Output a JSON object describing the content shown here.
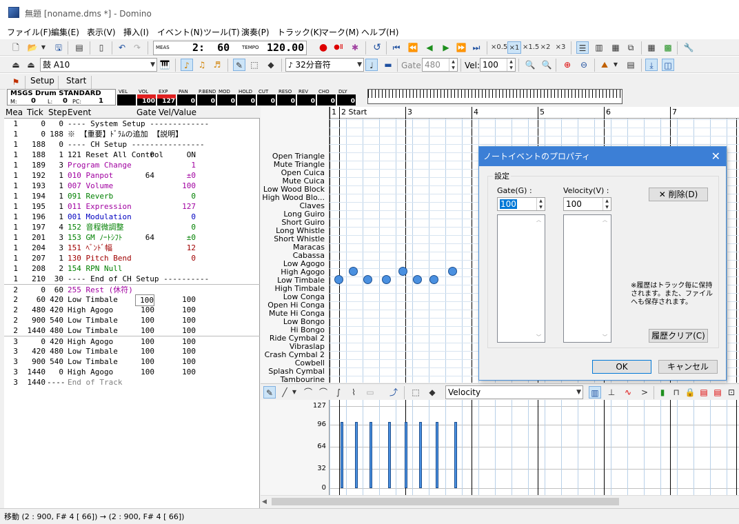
{
  "window": {
    "title": "無題 [noname.dms *] - Domino"
  },
  "menu": [
    "ファイル(F)",
    "編集(E)",
    "表示(V)",
    "挿入(I)",
    "イベント(N)",
    "ツール(T)",
    "演奏(P)",
    "トラック(K)",
    "マーク(M)",
    "ヘルプ(H)"
  ],
  "toolbar1": {
    "meas_label": "MEAS",
    "position": "2:  60",
    "tempo_label": "TEMPO",
    "tempo": "120.00",
    "speeds": [
      "×0.5",
      "×1",
      "×1.5",
      "×2",
      "×3"
    ]
  },
  "toolbar2": {
    "instrument": "鼓 A10",
    "note_length": "32分音符",
    "gate_label": "Gate:",
    "gate_value": "480",
    "vel_label": "Vel:",
    "vel_value": "100"
  },
  "toolbar3": {
    "setup": "Setup",
    "start": "Start"
  },
  "channel_info": {
    "device": "MSGS Drum STANDARD",
    "m_label": "M:",
    "m_value": "0",
    "l_label": "L:",
    "l_value": "0",
    "pc_label": "PC:",
    "pc_value": "1",
    "meters": [
      {
        "label": "VEL",
        "value": ""
      },
      {
        "label": "VOL",
        "value": "100"
      },
      {
        "label": "EXP",
        "value": "127"
      },
      {
        "label": "PAN",
        "value": "0"
      },
      {
        "label": "P.BEND",
        "value": "0"
      },
      {
        "label": "MOD",
        "value": "0"
      },
      {
        "label": "HOLD",
        "value": "0"
      },
      {
        "label": "CUT",
        "value": "0"
      },
      {
        "label": "RESO",
        "value": "0"
      },
      {
        "label": "REV",
        "value": "0"
      },
      {
        "label": "CHO",
        "value": "0"
      },
      {
        "label": "DLY",
        "value": "0"
      }
    ]
  },
  "event_list": {
    "headers": [
      "Mea",
      "Tick",
      "Step",
      "Event",
      "Gate",
      "Vel/Value"
    ],
    "rows": [
      [
        "1",
        "0",
        "0",
        "---- System Setup -------------",
        "",
        "",
        "#000"
      ],
      [
        "1",
        "0",
        "188",
        "※ 【重要】ﾄﾞﾗﾑの追加 【説明】",
        "",
        "",
        "#000"
      ],
      [
        "1",
        "188",
        "0",
        "---- CH Setup ----------------",
        "",
        "",
        "#000"
      ],
      [
        "1",
        "188",
        "1",
        "121 Reset All Control",
        "0",
        "ON",
        "#000"
      ],
      [
        "1",
        "189",
        "3",
        "Program Change",
        "",
        "1",
        "#a000a0"
      ],
      [
        "1",
        "192",
        "1",
        "010 Panpot",
        "64",
        "±0",
        "#a000a0"
      ],
      [
        "1",
        "193",
        "1",
        "007 Volume",
        "",
        "100",
        "#a000a0"
      ],
      [
        "1",
        "194",
        "1",
        "091 Reverb",
        "",
        "0",
        "#008000"
      ],
      [
        "1",
        "195",
        "1",
        "011 Expression",
        "",
        "127",
        "#a000a0"
      ],
      [
        "1",
        "196",
        "1",
        "001 Modulation",
        "",
        "0",
        "#0000c0"
      ],
      [
        "1",
        "197",
        "4",
        "152 音程微調整",
        "",
        "0",
        "#008000"
      ],
      [
        "1",
        "201",
        "3",
        "153 GM ﾉｰﾄｼﾌﾄ",
        "64",
        "±0",
        "#008000"
      ],
      [
        "1",
        "204",
        "3",
        "151 ﾍﾞﾝﾄﾞ幅",
        "",
        "12",
        "#a00000"
      ],
      [
        "1",
        "207",
        "1",
        "130 Pitch Bend",
        "",
        "0",
        "#a00000"
      ],
      [
        "1",
        "208",
        "2",
        "154 RPN Null",
        "",
        "",
        "#008000"
      ],
      [
        "1",
        "210",
        "30",
        "---- End of CH Setup ----------",
        "",
        "",
        "#000"
      ],
      [
        "2",
        "0",
        "60",
        "255 Rest (休符)",
        "",
        "",
        "#a000a0"
      ],
      [
        "2",
        "60",
        "420",
        "Low Timbale",
        "100",
        "100",
        "#000"
      ],
      [
        "2",
        "480",
        "420",
        "High Agogo",
        "100",
        "100",
        "#000"
      ],
      [
        "2",
        "900",
        "540",
        "Low Timbale",
        "100",
        "100",
        "#000"
      ],
      [
        "2",
        "1440",
        "480",
        "Low Timbale",
        "100",
        "100",
        "#000"
      ],
      [
        "3",
        "0",
        "420",
        "High Agogo",
        "100",
        "100",
        "#000"
      ],
      [
        "3",
        "420",
        "480",
        "Low Timbale",
        "100",
        "100",
        "#000"
      ],
      [
        "3",
        "900",
        "540",
        "Low Timbale",
        "100",
        "100",
        "#000"
      ],
      [
        "3",
        "1440",
        "0",
        "High Agogo",
        "100",
        "100",
        "#000"
      ],
      [
        "3",
        "1440",
        "----",
        "End of Track",
        "",
        "",
        "#808080"
      ]
    ]
  },
  "piano_roll": {
    "measures": [
      "1",
      "2 Start",
      "3",
      "4",
      "5",
      "6",
      "7"
    ],
    "note_names": [
      "Open Triangle",
      "Mute Triangle",
      "Open Cuica",
      "Mute Cuica",
      "Low Wood Block",
      "High Wood Blo...",
      "Claves",
      "Long Guiro",
      "Short Guiro",
      "Long Whistle",
      "Short Whistle",
      "Maracas",
      "Cabassa",
      "Low Agogo",
      "High Agogo",
      "Low Timbale",
      "High Timbale",
      "Low Conga",
      "Open Hi Conga",
      "Mute Hi Conga",
      "Low Bongo",
      "Hi Bongo",
      "Ride Cymbal 2",
      "Vibraslap",
      "Crash Cymbal 2",
      "Cowbell",
      "Splash Cymbal",
      "Tambourine"
    ]
  },
  "controller": {
    "type": "Velocity",
    "scale": [
      "127",
      "96",
      "64",
      "32",
      "0"
    ]
  },
  "dialog": {
    "title": "ノートイベントのプロパティ",
    "group_label": "設定",
    "gate_label": "Gate(G) :",
    "gate_value": "100",
    "velocity_label": "Velocity(V) :",
    "velocity_value": "100",
    "delete_button": "削除(D)",
    "note": "※履歴はトラック毎に保持されます。また、ファイルへも保存されます。",
    "clear_button": "履歴クリア(C)",
    "ok_button": "OK",
    "cancel_button": "キャンセル"
  },
  "statusbar": {
    "text": "移動 (2 : 900, F# 4 [ 66]) → (2 : 900, F# 4 [ 66])"
  }
}
